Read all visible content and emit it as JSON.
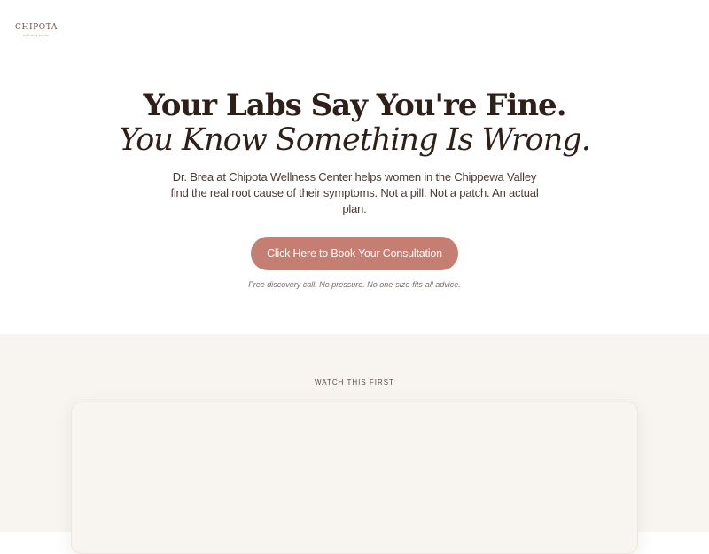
{
  "header": {
    "logo_name": "CHIPOTA",
    "logo_tagline": "wellness center"
  },
  "hero": {
    "headline": "Your Labs Say You're Fine.",
    "headline_italic": "You Know Something Is Wrong.",
    "subtext": "Dr. Brea at Chipota Wellness Center helps women in the Chippewa Valley find the real root cause of their symptoms. Not a pill. Not a patch. An actual plan.",
    "cta_label": "Click Here to Book Your Consultation",
    "cta_note": "Free discovery call. No pressure. No one-size-fits-all advice."
  },
  "video_section": {
    "label": "WATCH THIS FIRST"
  },
  "colors": {
    "accent": "#c57f72",
    "heading": "#2e1f18",
    "section_bg": "#f8f5f1"
  }
}
